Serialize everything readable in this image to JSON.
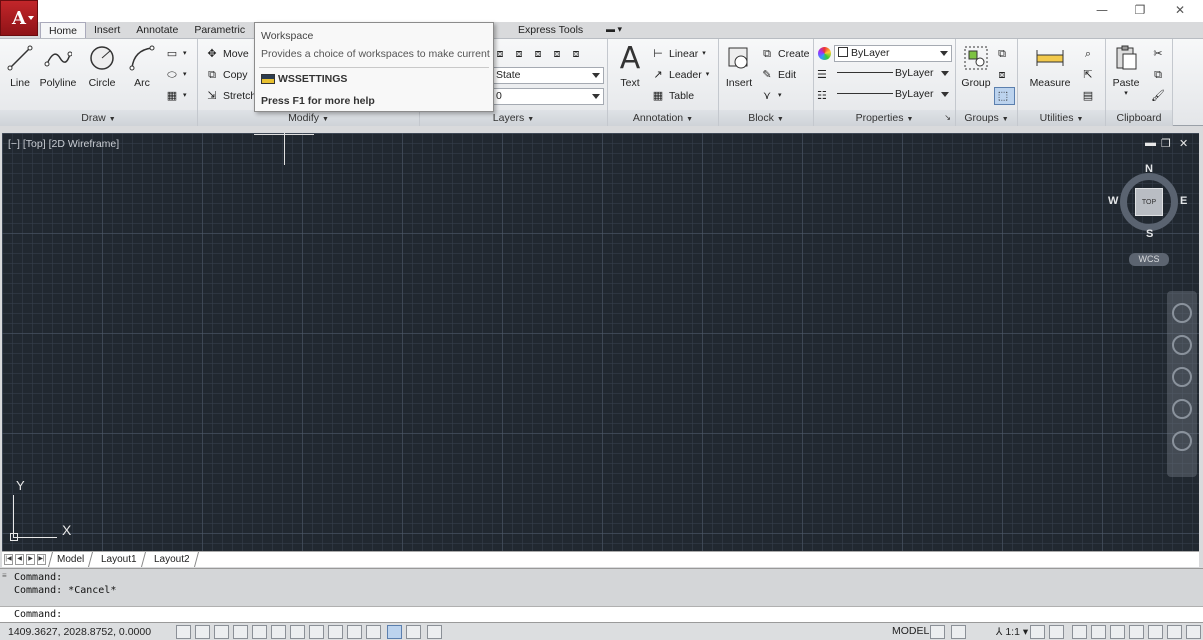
{
  "app_button": {
    "logo": "A"
  },
  "window_controls": {
    "minimize": "—",
    "restore": "❐",
    "close": "✕"
  },
  "tabs": [
    {
      "label": "Home"
    },
    {
      "label": "Insert"
    },
    {
      "label": "Annotate"
    },
    {
      "label": "Parametric"
    },
    {
      "label": "Express Tools"
    }
  ],
  "ribbon": {
    "draw": {
      "title": "Draw",
      "line": "Line",
      "polyline": "Polyline",
      "circle": "Circle",
      "arc": "Arc"
    },
    "modify": {
      "title": "Modify",
      "move": "Move",
      "copy": "Copy",
      "stretch": "Stretch"
    },
    "layers": {
      "title": "Layers",
      "state_combo": "State",
      "layer_combo": "0"
    },
    "annotation": {
      "title": "Annotation",
      "text": "Text",
      "linear": "Linear",
      "leader": "Leader",
      "table": "Table"
    },
    "block": {
      "title": "Block",
      "insert": "Insert",
      "create": "Create",
      "edit": "Edit"
    },
    "properties": {
      "title": "Properties",
      "color": "ByLayer",
      "linetype": "ByLayer",
      "lineweight": "ByLayer"
    },
    "groups": {
      "title": "Groups",
      "group": "Group"
    },
    "utilities": {
      "title": "Utilities",
      "measure": "Measure"
    },
    "clipboard": {
      "title": "Clipboard",
      "paste": "Paste"
    }
  },
  "tooltip": {
    "title": "Workspace",
    "description": "Provides a choice of workspaces to make current",
    "command": "WSSETTINGS",
    "help": "Press F1 for more help"
  },
  "viewport": {
    "label": "[−] [Top] [2D Wireframe]",
    "minimize": "▬",
    "restore": "❐",
    "close": "✕"
  },
  "viewcube": {
    "north": "N",
    "south": "S",
    "east": "E",
    "west": "W",
    "face": "TOP",
    "wcs": "WCS"
  },
  "ucs": {
    "x": "X",
    "y": "Y"
  },
  "layout_tabs": [
    {
      "label": "Model"
    },
    {
      "label": "Layout1"
    },
    {
      "label": "Layout2"
    }
  ],
  "command": {
    "history": [
      "Command:",
      "Command: *Cancel*"
    ],
    "prompt": "Command:"
  },
  "statusbar": {
    "coords": "1409.3627, 2028.8752, 0.0000",
    "model": "MODEL",
    "scale": "1:1"
  }
}
